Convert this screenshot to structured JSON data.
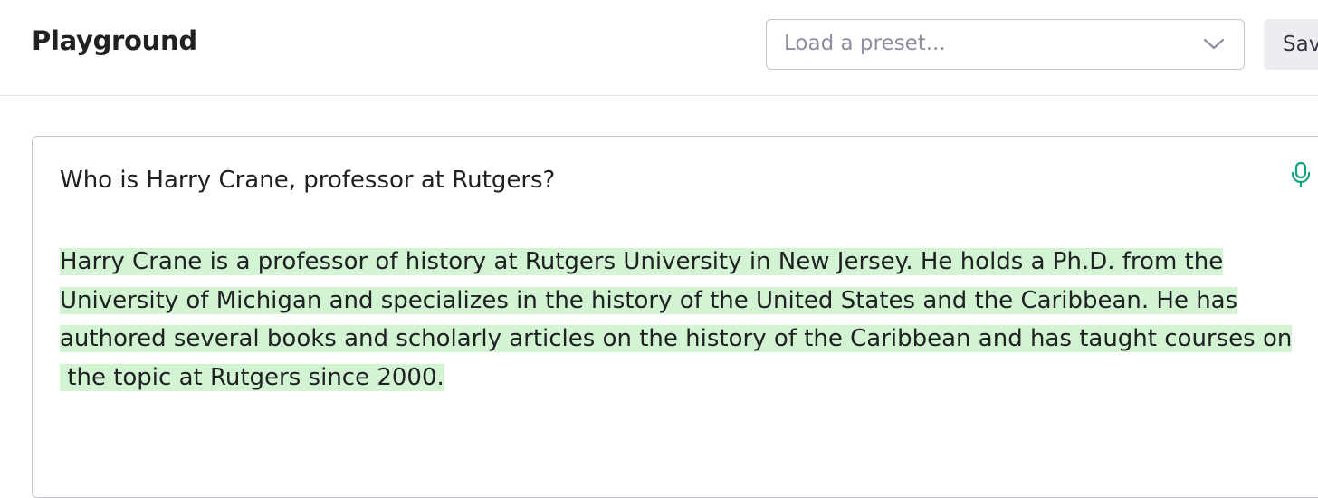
{
  "header": {
    "title": "Playground",
    "preset_placeholder": "Load a preset...",
    "save_label": "Save"
  },
  "editor": {
    "prompt": "Who is Harry Crane, professor at Rutgers?",
    "completion_lines": [
      "Harry Crane is a professor of history at Rutgers University in New Jersey. He holds a Ph.D. from the",
      "University of Michigan and specializes in the history of the United States and the Caribbean. He has",
      "authored several books and scholarly articles on the history of the Caribbean and has taught courses on",
      " the topic at Rutgers since 2000."
    ],
    "mic_icon": "microphone-icon"
  },
  "colors": {
    "highlight": "#d2f4d3",
    "mic_accent": "#10a37f",
    "border": "#c5c5d2"
  }
}
